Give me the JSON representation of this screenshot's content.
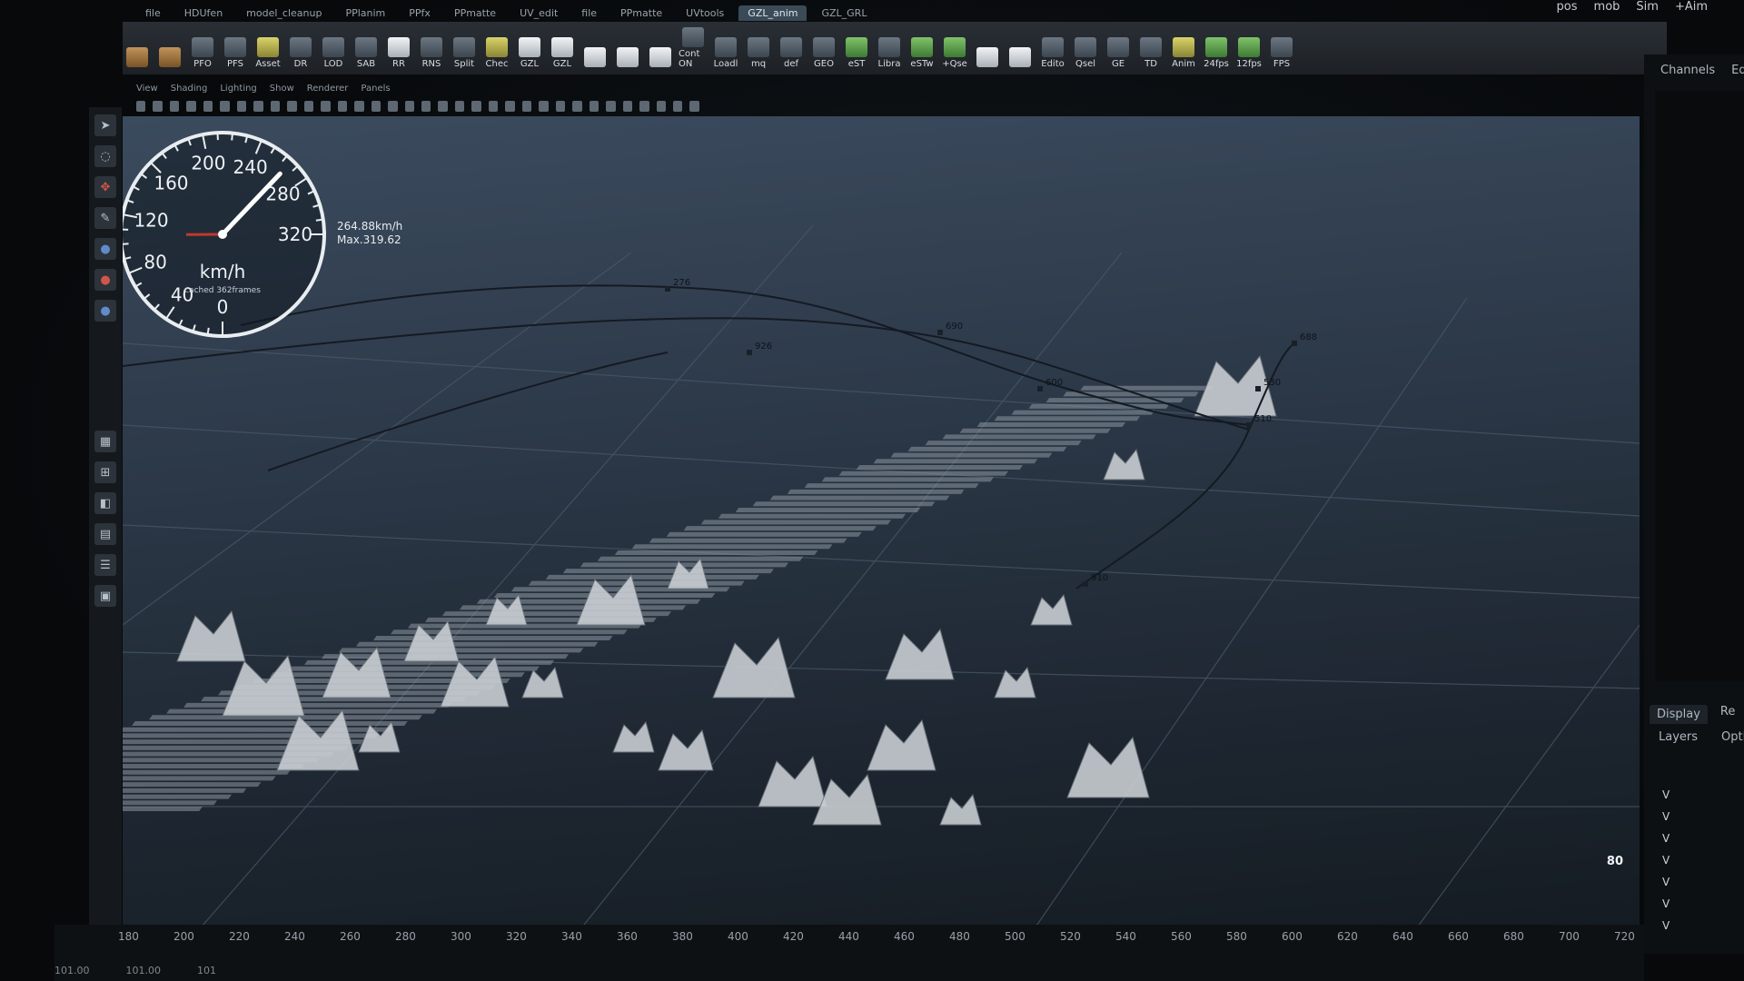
{
  "shelf_tabs": [
    "file",
    "HDUfen",
    "model_cleanup",
    "PPlanim",
    "PPfx",
    "PPmatte",
    "UV_edit",
    "file",
    "PPmatte",
    "UVtools",
    "GZL_anim",
    "GZL_GRL"
  ],
  "active_shelf_tab": "GZL_anim",
  "shelf_tools": [
    {
      "label": "",
      "style": "brown"
    },
    {
      "label": "",
      "style": "brown"
    },
    {
      "label": "PFO",
      "style": ""
    },
    {
      "label": "PFS",
      "style": ""
    },
    {
      "label": "Asset",
      "style": "yellow"
    },
    {
      "label": "DR",
      "style": ""
    },
    {
      "label": "LOD",
      "style": ""
    },
    {
      "label": "SAB",
      "style": ""
    },
    {
      "label": "RR",
      "style": "white"
    },
    {
      "label": "RNS",
      "style": ""
    },
    {
      "label": "Split",
      "style": ""
    },
    {
      "label": "Chec",
      "style": "yellow"
    },
    {
      "label": "GZL",
      "style": "white"
    },
    {
      "label": "GZL",
      "style": "white"
    },
    {
      "label": "",
      "style": "white"
    },
    {
      "label": "",
      "style": "white"
    },
    {
      "label": "",
      "style": "white"
    },
    {
      "label": "Cont ON",
      "style": ""
    },
    {
      "label": "Loadl",
      "style": ""
    },
    {
      "label": "mq",
      "style": ""
    },
    {
      "label": "def",
      "style": ""
    },
    {
      "label": "GEO",
      "style": ""
    },
    {
      "label": "eST",
      "style": "green"
    },
    {
      "label": "Libra",
      "style": ""
    },
    {
      "label": "eSTw",
      "style": "green"
    },
    {
      "label": "+Qse",
      "style": "green"
    },
    {
      "label": "",
      "style": "white"
    },
    {
      "label": "",
      "style": "white"
    },
    {
      "label": "Edito",
      "style": ""
    },
    {
      "label": "Qsel",
      "style": ""
    },
    {
      "label": "GE",
      "style": ""
    },
    {
      "label": "TD",
      "style": ""
    },
    {
      "label": "Anim",
      "style": "yellow"
    },
    {
      "label": "24fps",
      "style": "green"
    },
    {
      "label": "12fps",
      "style": "green"
    },
    {
      "label": "FPS",
      "style": ""
    }
  ],
  "top_right_labels": [
    "pos",
    "mob",
    "Sim",
    "+Aim"
  ],
  "viewport_menu": [
    "View",
    "Shading",
    "Lighting",
    "Show",
    "Renderer",
    "Panels"
  ],
  "speedometer": {
    "unit": "km/h",
    "cached_text": "cached 362frames",
    "ticks": [
      "0",
      "40",
      "80",
      "120",
      "160",
      "200",
      "240",
      "280",
      "320"
    ],
    "current_text": "264.88km/h",
    "max_text": "Max.319.62",
    "current_value": 264.88,
    "max_value": 319.62
  },
  "path_keys": [
    "276",
    "690",
    "600",
    "926",
    "510",
    "688",
    "530",
    "910"
  ],
  "frame_counter": "80",
  "right_panel": {
    "top_tabs": [
      "Channels",
      "Ed"
    ],
    "bottom_tabs": [
      "Display",
      "Re"
    ],
    "sub_tabs": [
      "Layers",
      "Optio"
    ],
    "layer_rows": [
      "V",
      "V",
      "V",
      "V",
      "V",
      "V",
      "V"
    ]
  },
  "timeline": {
    "ticks": [
      "180",
      "200",
      "220",
      "240",
      "260",
      "280",
      "300",
      "320",
      "340",
      "360",
      "380",
      "400",
      "420",
      "440",
      "460",
      "480",
      "500",
      "520",
      "540",
      "560",
      "580",
      "600",
      "620",
      "640",
      "660",
      "680",
      "700",
      "720"
    ],
    "range_start": "101.00",
    "range_current": "101.00",
    "range_field": "101"
  },
  "colors": {
    "viewport_top": "#3b4b5e",
    "viewport_bottom": "#141b22",
    "speedometer_ring": "#e9edf0",
    "needle": "#ffffff",
    "max_needle": "#c0392b"
  }
}
